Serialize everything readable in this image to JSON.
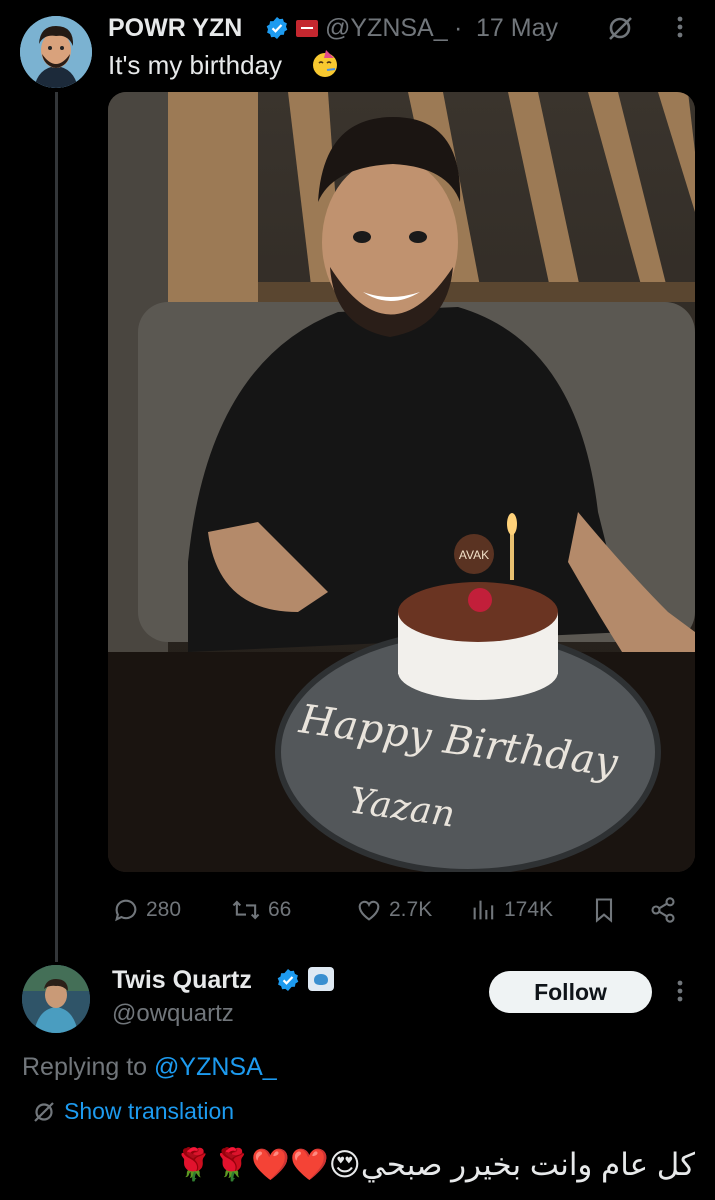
{
  "tweet": {
    "author_name": "POWR YZN",
    "handle": "@YZNSA_",
    "separator": "·",
    "date": "17 May",
    "text": "It's my birthday",
    "photo": {
      "badge": "AVAK",
      "cake_writing_line1": "Happy Birthday",
      "cake_writing_line2": "Yazan"
    },
    "stats": {
      "replies": "280",
      "reposts": "66",
      "likes": "2.7K",
      "views": "174K"
    }
  },
  "reply": {
    "author_name": "Twis Quartz",
    "handle": "@owquartz",
    "follow_label": "Follow",
    "replying_prefix": "Replying to",
    "replying_to": "@YZNSA_",
    "translate_label": "Show translation",
    "text": "كل عام وانت بخيرر صبحي😍❤️❤️🌹🌹"
  },
  "colors": {
    "accent": "#1d9bf0",
    "muted": "#71767b",
    "text": "#e7e9ea",
    "background": "#000000"
  },
  "icons": [
    "verified-badge-icon",
    "flag-icon",
    "grok-icon",
    "more-icon",
    "party-face-icon",
    "reply-icon",
    "repost-icon",
    "like-icon",
    "views-icon",
    "bookmark-icon",
    "share-icon",
    "brain-icon",
    "translate-icon"
  ]
}
